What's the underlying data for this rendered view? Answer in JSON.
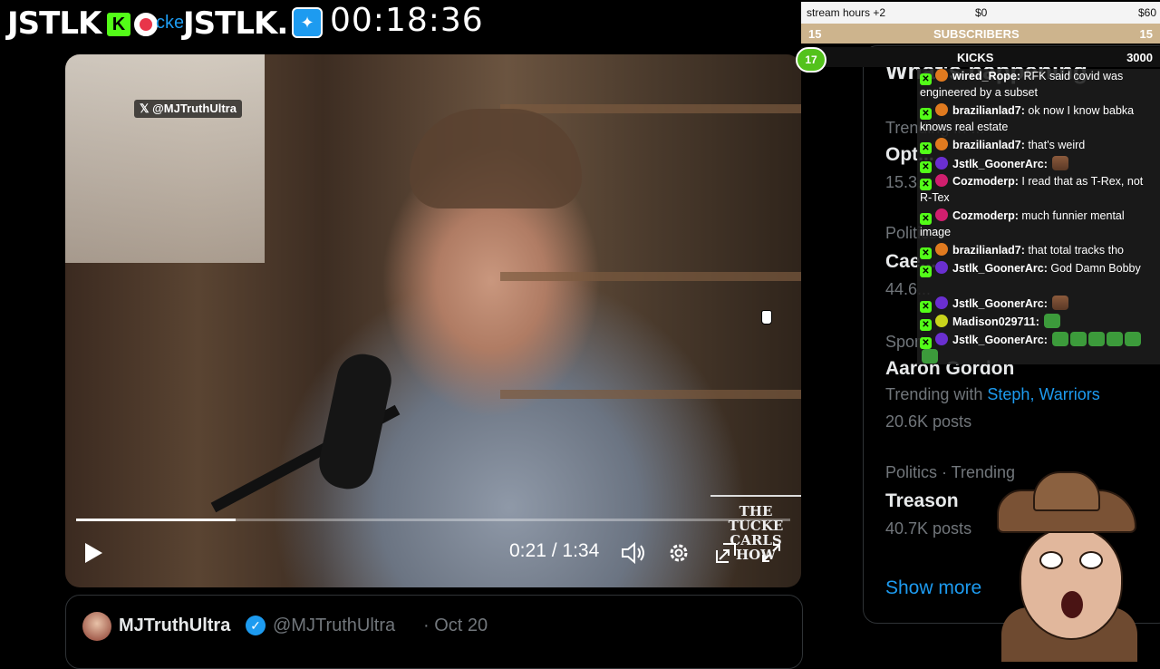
{
  "overlay": {
    "brand_left": "JSTLK",
    "kick_letter": "K",
    "ghost_text": "cke",
    "brand_right": "JSTLK.",
    "timer": "00:18:36"
  },
  "video": {
    "watermark": "@MJTruthUltra",
    "show_logo": [
      "THE",
      "TUCKE",
      "CARLS",
      "HOW"
    ],
    "current_time": "0:21",
    "duration": "1:34",
    "time_separator": " / ",
    "progress": 0.223
  },
  "tweet": {
    "name": "MJTruthUltra",
    "handle": "@MJTruthUltra",
    "date": "· Oct 20"
  },
  "trends": {
    "title": "What's happening",
    "items": [
      {
        "meta": "Trending in ...",
        "topic": "Opt...",
        "count": "15.3..."
      },
      {
        "meta": "Politics",
        "topic": "Cae...",
        "count": "44.6..."
      },
      {
        "meta": "Sports",
        "topic": "Aaron Gordon",
        "with_label": "Trending with ",
        "with_links": [
          "Steph",
          "Warriors"
        ],
        "count": "20.6K posts"
      },
      {
        "meta": "Politics · Trending",
        "topic": "Treason",
        "count": "40.7K posts"
      }
    ],
    "show_more": "Show more"
  },
  "goal": {
    "label": "stream hours +2",
    "current": "$0",
    "target": "$60"
  },
  "subs": {
    "left": "15",
    "label": "SUBSCRIBERS",
    "right": "15"
  },
  "kicks": {
    "badge": "17",
    "label": "KICKS",
    "target": "3000"
  },
  "chat": [
    {
      "user": "wired_Rope",
      "text": "RFK said covid was engineered by a subset",
      "color": "#e07a1f"
    },
    {
      "user": "brazilianlad7",
      "text": "ok now I know babka knows real estate",
      "color": "#e07a1f"
    },
    {
      "user": "brazilianlad7",
      "text": "that's weird",
      "color": "#e07a1f"
    },
    {
      "user": "Jstlk_GoonerArc",
      "text": "",
      "color": "#6a2fd0",
      "emotes": [
        "face"
      ]
    },
    {
      "user": "Cozmoderp",
      "text": "I read that as T-Rex, not R-Tex",
      "color": "#d01f6e"
    },
    {
      "user": "Cozmoderp",
      "text": "much funnier mental image",
      "color": "#d01f6e"
    },
    {
      "user": "brazilianlad7",
      "text": "that total tracks tho",
      "color": "#e07a1f"
    },
    {
      "user": "Jstlk_GoonerArc",
      "text": "God Damn Bobby",
      "color": "#6a2fd0"
    },
    {
      "user": "Jstlk_GoonerArc",
      "text": "",
      "color": "#6a2fd0",
      "emotes": [
        "face"
      ]
    },
    {
      "user": "Madison029711",
      "text": "",
      "color": "#c8d41c",
      "emotes": [
        "pepe"
      ]
    },
    {
      "user": "Jstlk_GoonerArc",
      "text": "",
      "color": "#6a2fd0",
      "emotes": [
        "pepe",
        "pepe",
        "pepe",
        "pepe",
        "pepe",
        "pepe"
      ]
    }
  ]
}
